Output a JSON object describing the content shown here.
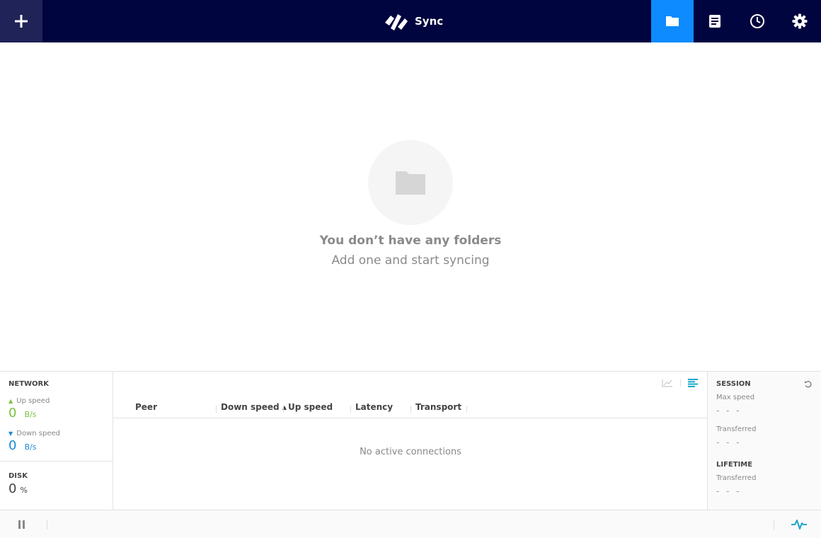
{
  "header": {
    "app_name": "Sync",
    "add_icon": "plus-icon",
    "nav": [
      {
        "name": "folders",
        "icon": "folder-icon",
        "active": true
      },
      {
        "name": "notes",
        "icon": "document-icon",
        "active": false
      },
      {
        "name": "history",
        "icon": "clock-icon",
        "active": false
      },
      {
        "name": "settings",
        "icon": "gear-icon",
        "active": false
      }
    ]
  },
  "empty_state": {
    "title": "You don’t have any folders",
    "subtitle": "Add one and start syncing"
  },
  "network": {
    "title": "NETWORK",
    "up_label": "Up speed",
    "up_value": "0",
    "up_unit": "B/s",
    "down_label": "Down speed",
    "down_value": "0",
    "down_unit": "B/s"
  },
  "disk": {
    "title": "DISK",
    "value": "0",
    "unit": "%"
  },
  "peers_table": {
    "columns": [
      "Peer",
      "Down speed",
      "Up speed",
      "Latency",
      "Transport"
    ],
    "empty": "No active connections"
  },
  "session": {
    "title": "SESSION",
    "max_speed_label": "Max speed",
    "max_speed_value": "- - -",
    "transferred_label": "Transferred",
    "transferred_value": "- - -"
  },
  "lifetime": {
    "title": "LIFETIME",
    "transferred_label": "Transferred",
    "transferred_value": "- - -"
  },
  "colors": {
    "header_bg": "#00043f",
    "accent": "#0d8bff",
    "up_green": "#7cc242",
    "down_blue": "#1a8ad8",
    "teal": "#1ba7c9"
  }
}
